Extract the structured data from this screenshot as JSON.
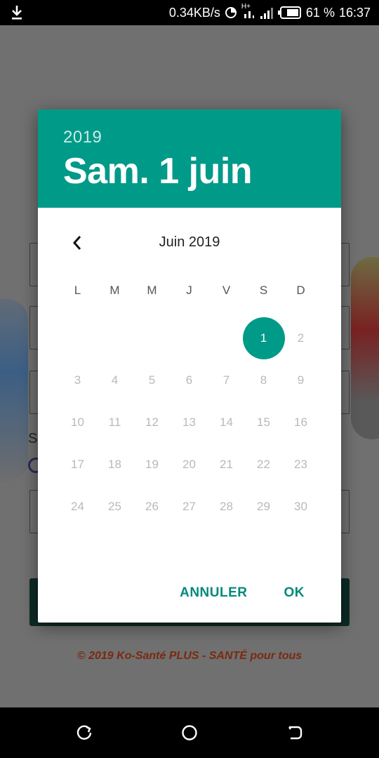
{
  "status_bar": {
    "speed": "0.34KB/s",
    "network_type": "H+",
    "battery": "61 %",
    "time": "16:37",
    "icons": [
      "download-icon",
      "sync-icon",
      "signal-icon",
      "battery-icon"
    ]
  },
  "background": {
    "label_partial": "S",
    "footer": "© 2019 Ko-Santé PLUS - SANTÉ pour tous"
  },
  "dialog": {
    "year": "2019",
    "selected_date": "Sam. 1 juin",
    "month_title": "Juin 2019",
    "weekdays": [
      "L",
      "M",
      "M",
      "J",
      "V",
      "S",
      "D"
    ],
    "weeks": [
      [
        "",
        "",
        "",
        "",
        "",
        "1",
        "2"
      ],
      [
        "3",
        "4",
        "5",
        "6",
        "7",
        "8",
        "9"
      ],
      [
        "10",
        "11",
        "12",
        "13",
        "14",
        "15",
        "16"
      ],
      [
        "17",
        "18",
        "19",
        "20",
        "21",
        "22",
        "23"
      ],
      [
        "24",
        "25",
        "26",
        "27",
        "28",
        "29",
        "30"
      ]
    ],
    "selected_day": "1",
    "cancel_label": "ANNULER",
    "ok_label": "OK",
    "accent_color": "#009a88"
  },
  "nav_bar": {
    "icons": [
      "recent-apps-icon",
      "home-icon",
      "back-icon"
    ]
  }
}
